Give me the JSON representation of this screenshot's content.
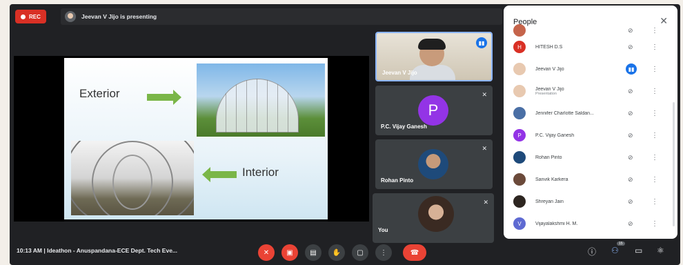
{
  "topbar": {
    "rec_label": "REC",
    "presenting_text": "Jeevan V Jijo is presenting"
  },
  "slide": {
    "exterior_label": "Exterior",
    "interior_label": "Interior"
  },
  "tiles": [
    {
      "name": "Jeevan V Jijo",
      "speaking": true
    },
    {
      "name": "P.C. Vijay Ganesh",
      "avatar_letter": "P",
      "avatar_color": "#9334e6"
    },
    {
      "name": "Rohan Pinto"
    },
    {
      "name": "You"
    }
  ],
  "people_panel": {
    "title": "People",
    "close_icon": "close-icon",
    "participants": [
      {
        "name": "",
        "sub": "",
        "avatar": "",
        "color": "#c5644b",
        "mic": "muted"
      },
      {
        "name": "HITESH D.S",
        "sub": "",
        "avatar": "H",
        "color": "#d93025",
        "mic": "muted"
      },
      {
        "name": "Jeevan V Jijo",
        "sub": "",
        "avatar": "",
        "color": "#e8c9b0",
        "mic": "speaking"
      },
      {
        "name": "Jeevan V Jijo",
        "sub": "Presentation",
        "avatar": "",
        "color": "#e8c9b0",
        "mic": "presenting"
      },
      {
        "name": "Jennifer Charlotte Saldan...",
        "sub": "",
        "avatar": "",
        "color": "#4a6fa5",
        "mic": "muted"
      },
      {
        "name": "P.C. Vijay Ganesh",
        "sub": "",
        "avatar": "P",
        "color": "#9334e6",
        "mic": "muted"
      },
      {
        "name": "Rohan Pinto",
        "sub": "",
        "avatar": "",
        "color": "#1e4a7a",
        "mic": "muted"
      },
      {
        "name": "Sanvik Karkera",
        "sub": "",
        "avatar": "",
        "color": "#6b4a3a",
        "mic": "muted"
      },
      {
        "name": "Shreyan Jain",
        "sub": "",
        "avatar": "",
        "color": "#2d2520",
        "mic": "muted"
      },
      {
        "name": "Vijayalakshmi H. M.",
        "sub": "",
        "avatar": "V",
        "color": "#5e6ad2",
        "mic": "muted"
      }
    ]
  },
  "bottombar": {
    "meeting_info": "10:13 AM  |  Ideathon - Anuspandana-ECE Dept. Tech Eve...",
    "people_count": "15"
  },
  "colors": {
    "meet_bg": "#202124",
    "tile_bg": "#3c4043",
    "accent_blue": "#1a73e8",
    "danger_red": "#ea4335"
  }
}
